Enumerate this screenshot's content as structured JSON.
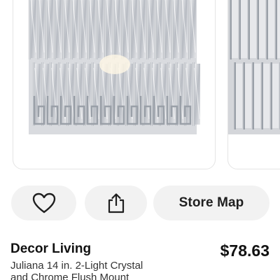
{
  "product": {
    "brand": "Decor Living",
    "price": "$78.63",
    "title_lines": [
      "Juliana 14 in. 2-Light Crystal",
      "and Chrome Flush Mount"
    ]
  },
  "actions": {
    "favorite_icon": "heart-icon",
    "share_icon": "share-icon",
    "store_map_label": "Store Map"
  },
  "carousel": {
    "images": [
      "chandelier-front-view",
      "chandelier-detail-view"
    ]
  },
  "colors": {
    "button_bg": "#f2f2f2",
    "text_primary": "#111111",
    "chrome": "#c9ccd2"
  }
}
